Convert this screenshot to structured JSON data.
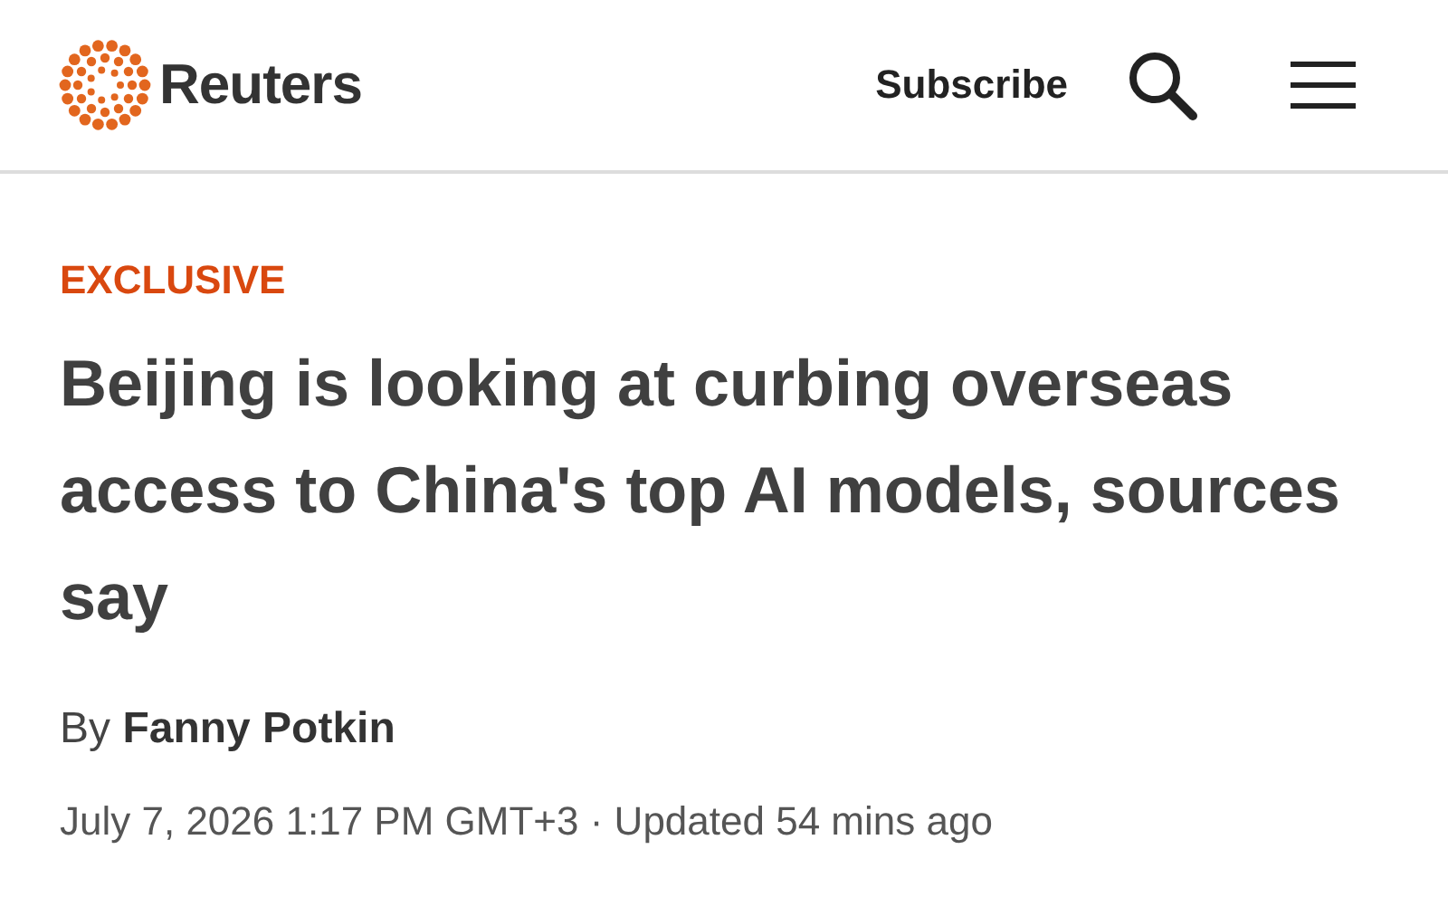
{
  "header": {
    "logo": "Reuters",
    "subscribe": "Subscribe"
  },
  "article": {
    "label": "EXCLUSIVE",
    "headline": "Beijing is looking at curbing overseas access to China's top AI models, sources say",
    "byline": "By **Fanny Potkin**",
    "dateline": "July 7, 2026 1:17 PM GMT+3 · Updated 54 mins ago"
  }
}
